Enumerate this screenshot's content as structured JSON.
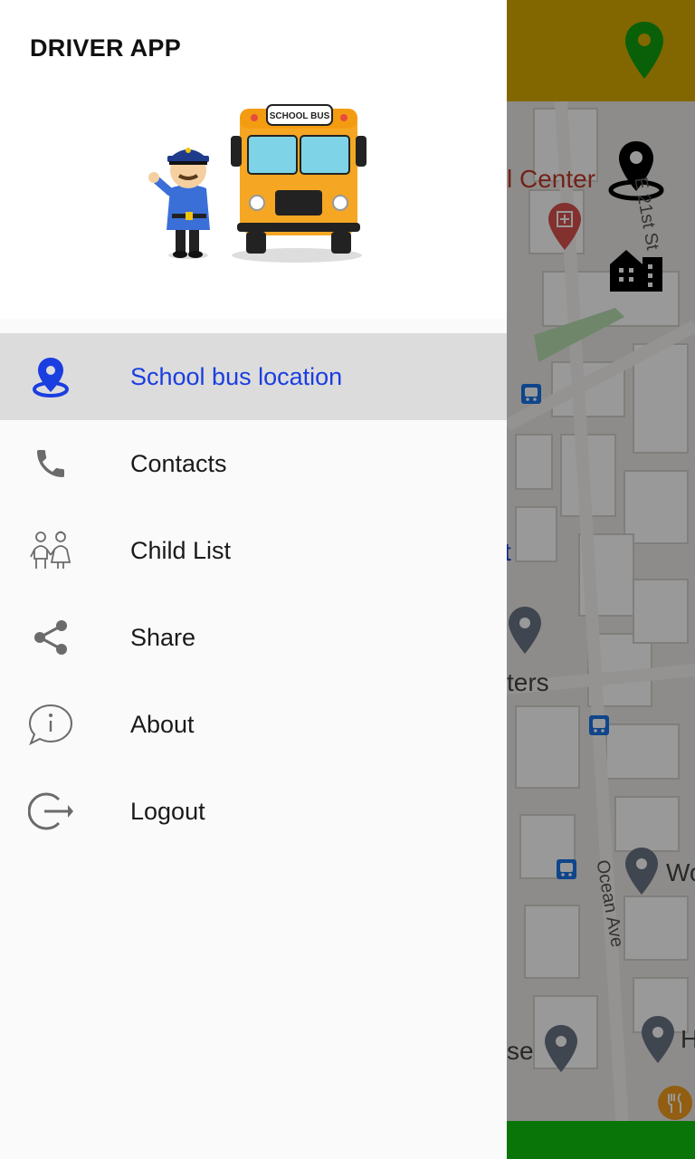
{
  "app": {
    "title": "DRIVER APP"
  },
  "menu": {
    "items": [
      {
        "label": "School bus location",
        "icon": "location-pin-icon",
        "active": true
      },
      {
        "label": "Contacts",
        "icon": "phone-icon",
        "active": false
      },
      {
        "label": "Child List",
        "icon": "children-icon",
        "active": false
      },
      {
        "label": "Share",
        "icon": "share-icon",
        "active": false
      },
      {
        "label": "About",
        "icon": "info-icon",
        "active": false
      },
      {
        "label": "Logout",
        "icon": "logout-icon",
        "active": false
      }
    ]
  },
  "header_art": {
    "bus_sign": "SCHOOL BUS"
  },
  "map": {
    "labels": {
      "center": "l Center",
      "street": "E 21st St",
      "t_fragment": "t",
      "ters": "ters",
      "ocean_ave": "Ocean Ave",
      "wo": "Wo",
      "se": "se",
      "h": "H"
    }
  },
  "colors": {
    "toolbar": "#d9ac00",
    "accent": "#1a3ee0",
    "active_item_bg": "#dcdcdc",
    "location_button": "#10a010",
    "bottom_bar": "#10c410"
  }
}
